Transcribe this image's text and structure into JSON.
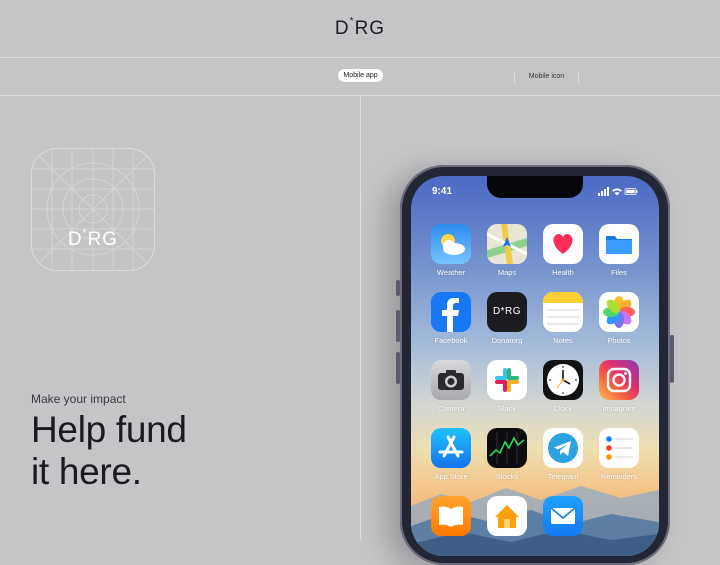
{
  "header": {
    "brand": "D",
    "brand_mark": "*",
    "brand_rest": "RG"
  },
  "nav": {
    "active_pill": "Mobile app",
    "tab_icon": "Mobile icon"
  },
  "icon_preview": {
    "label": "D",
    "mark": "*",
    "label_rest": "RG"
  },
  "hero": {
    "kicker": "Make your impact",
    "line1": "Help fund",
    "line2": "it here."
  },
  "phone": {
    "time": "9:41",
    "apps": [
      {
        "label": "Weather",
        "icon": "weather-icon"
      },
      {
        "label": "Maps",
        "icon": "maps-icon"
      },
      {
        "label": "Health",
        "icon": "health-icon"
      },
      {
        "label": "Files",
        "icon": "files-icon"
      },
      {
        "label": "Facebook",
        "icon": "facebook-icon"
      },
      {
        "label": "Donatorg",
        "icon": "donatorg-icon",
        "icon_text": "D*RG"
      },
      {
        "label": "Notes",
        "icon": "notes-icon"
      },
      {
        "label": "Photos",
        "icon": "photos-icon"
      },
      {
        "label": "Camera",
        "icon": "camera-icon"
      },
      {
        "label": "Slack",
        "icon": "slack-icon"
      },
      {
        "label": "Clock",
        "icon": "clock-icon"
      },
      {
        "label": "Instagram",
        "icon": "instagram-icon"
      },
      {
        "label": "App Store",
        "icon": "app-store-icon"
      },
      {
        "label": "Stocks",
        "icon": "stocks-icon"
      },
      {
        "label": "Telegram",
        "icon": "telegram-icon"
      },
      {
        "label": "Reminders",
        "icon": "reminders-icon"
      },
      {
        "label": "",
        "icon": "books-icon"
      },
      {
        "label": "",
        "icon": "home-icon"
      },
      {
        "label": "",
        "icon": "mail-icon"
      }
    ]
  },
  "colors": {
    "background": "#c5c5c7",
    "divider": "#dedee0",
    "text": "#1e1e22"
  }
}
